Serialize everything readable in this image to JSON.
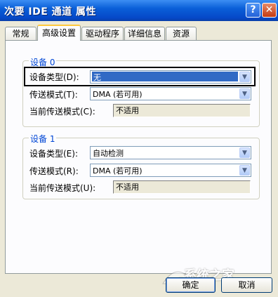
{
  "window": {
    "title": "次要 IDE 通道 属性",
    "help_button": "?",
    "close_button": "✕"
  },
  "tabs": [
    {
      "label": "常规",
      "active": false
    },
    {
      "label": "高级设置",
      "active": true
    },
    {
      "label": "驱动程序",
      "active": false
    },
    {
      "label": "详细信息",
      "active": false
    },
    {
      "label": "资源",
      "active": false
    }
  ],
  "device0": {
    "title": "设备 0",
    "device_type_label": "设备类型(D):",
    "device_type_value": "无",
    "transfer_mode_label": "传送模式(T):",
    "transfer_mode_value": "DMA (若可用)",
    "current_mode_label": "当前传送模式(C):",
    "current_mode_value": "不适用"
  },
  "device1": {
    "title": "设备 1",
    "device_type_label": "设备类型(E):",
    "device_type_value": "自动检测",
    "transfer_mode_label": "传送模式(R):",
    "transfer_mode_value": "DMA (若可用)",
    "current_mode_label": "当前传送模式(U):",
    "current_mode_value": "不适用"
  },
  "buttons": {
    "ok": "确定",
    "cancel": "取消"
  },
  "watermark": {
    "text": "系统之家"
  },
  "icons": {
    "dropdown": "chevron-down-icon",
    "logo": "watermark-logo-icon"
  },
  "colors": {
    "titlebar": "#0a5fd8",
    "selection": "#316ac5",
    "group_title": "#0046d5"
  }
}
